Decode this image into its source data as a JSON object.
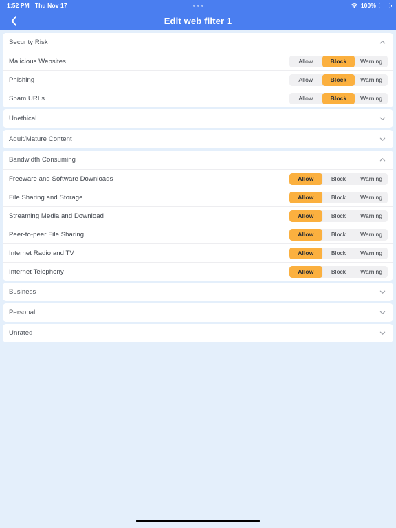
{
  "status_bar": {
    "time": "1:52 PM",
    "date": "Thu Nov 17",
    "battery_percent": "100%",
    "wifi_icon": "wifi-icon",
    "battery_icon": "battery-icon",
    "handle_dots": "more-dots-indicator"
  },
  "nav": {
    "back_icon": "chevron-left-icon",
    "title": "Edit web filter 1"
  },
  "segment_labels": {
    "allow": "Allow",
    "block": "Block",
    "warning": "Warning"
  },
  "colors": {
    "accent_orange": "#fbb03f",
    "nav_blue": "#4a7ef0",
    "page_background": "#e4effb",
    "card_background": "#ffffff",
    "segment_track": "#f0f0f2"
  },
  "sections": [
    {
      "title": "Security Risk",
      "expanded": true,
      "chevron": "chevron-up-icon",
      "rows": [
        {
          "label": "Malicious Websites",
          "selected": "Block"
        },
        {
          "label": "Phishing",
          "selected": "Block"
        },
        {
          "label": "Spam URLs",
          "selected": "Block"
        }
      ]
    },
    {
      "title": "Unethical",
      "expanded": false,
      "chevron": "chevron-down-icon",
      "rows": []
    },
    {
      "title": "Adult/Mature Content",
      "expanded": false,
      "chevron": "chevron-down-icon",
      "rows": []
    },
    {
      "title": "Bandwidth Consuming",
      "expanded": true,
      "chevron": "chevron-up-icon",
      "rows": [
        {
          "label": "Freeware and Software Downloads",
          "selected": "Allow"
        },
        {
          "label": "File Sharing and Storage",
          "selected": "Allow"
        },
        {
          "label": "Streaming Media and Download",
          "selected": "Allow"
        },
        {
          "label": "Peer-to-peer File Sharing",
          "selected": "Allow"
        },
        {
          "label": "Internet Radio and TV",
          "selected": "Allow"
        },
        {
          "label": "Internet Telephony",
          "selected": "Allow"
        }
      ]
    },
    {
      "title": "Business",
      "expanded": false,
      "chevron": "chevron-down-icon",
      "rows": []
    },
    {
      "title": "Personal",
      "expanded": false,
      "chevron": "chevron-down-icon",
      "rows": []
    },
    {
      "title": "Unrated",
      "expanded": false,
      "chevron": "chevron-down-icon",
      "rows": []
    }
  ]
}
